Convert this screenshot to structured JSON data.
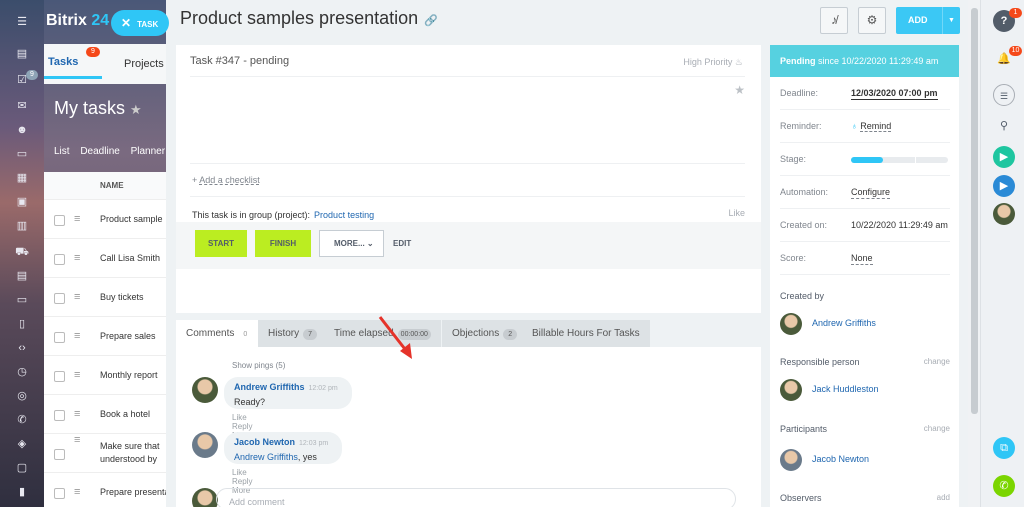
{
  "background": {
    "brand_main": "Bitrix",
    "brand_num": "24",
    "task_pill": "TASK",
    "tabs": [
      {
        "label": "Tasks",
        "badge": "9"
      },
      {
        "label": "Projects"
      }
    ],
    "rail_badges": [
      "9"
    ],
    "heading": "My tasks",
    "filters": "List Deadline Planner",
    "column_name": "NAME",
    "rows": [
      "Product sample",
      "Call Lisa Smith",
      "Buy tickets",
      "Prepare sales",
      "Monthly report",
      "Book a hotel",
      "Make sure that understood by",
      "Prepare presentation"
    ]
  },
  "header": {
    "title": "Product samples presentation",
    "add_label": "ADD"
  },
  "task": {
    "number": "Task #347 - pending",
    "priority": "High Priority",
    "checklist": "Add a checklist",
    "group_label": "This task is in group (project):",
    "group_link": "Product testing",
    "like": "Like"
  },
  "actions": {
    "start": "START",
    "finish": "FINISH",
    "more": "MORE...",
    "edit": "EDIT"
  },
  "tabs": [
    {
      "label": "Comments",
      "count": "0"
    },
    {
      "label": "History",
      "count": "7"
    },
    {
      "label": "Time elapsed",
      "count": "00:00:00"
    },
    {
      "label": "Objections",
      "count": "2"
    },
    {
      "label": "Billable Hours For Tasks"
    }
  ],
  "comments": {
    "pings": "Show pings (5)",
    "items": [
      {
        "author": "Andrew Griffiths",
        "time": "12:02 pm",
        "text": "Ready?"
      },
      {
        "author": "Jacob Newton",
        "time": "12:03 pm",
        "mention": "Andrew Griffiths",
        "text": ", yes"
      }
    ],
    "actions": [
      "Like",
      "Reply",
      "More"
    ],
    "placeholder": "Add comment"
  },
  "sidebar": {
    "status_bold": "Pending",
    "status_rest": " since 10/22/2020 11:29:49 am",
    "deadline_label": "Deadline:",
    "deadline": "12/03/2020 07:00 pm",
    "reminder_label": "Reminder:",
    "reminder": "Remind",
    "stage_label": "Stage:",
    "automation_label": "Automation:",
    "automation": "Configure",
    "created_label": "Created on:",
    "created": "10/22/2020 11:29:49 am",
    "score_label": "Score:",
    "score": "None",
    "created_by_label": "Created by",
    "created_by": "Andrew Griffiths",
    "responsible_label": "Responsible person",
    "responsible": "Jack Huddleston",
    "participants_label": "Participants",
    "participant": "Jacob Newton",
    "observers_label": "Observers",
    "change": "change",
    "add": "add"
  },
  "right_rail": {
    "badge_help": "1",
    "badge_bell": "10"
  },
  "colors": {
    "accent": "#2fc6f6",
    "status": "#56d1e0",
    "start_btn": "#bbed21",
    "link": "#2067b0",
    "badge": "#f54819"
  }
}
